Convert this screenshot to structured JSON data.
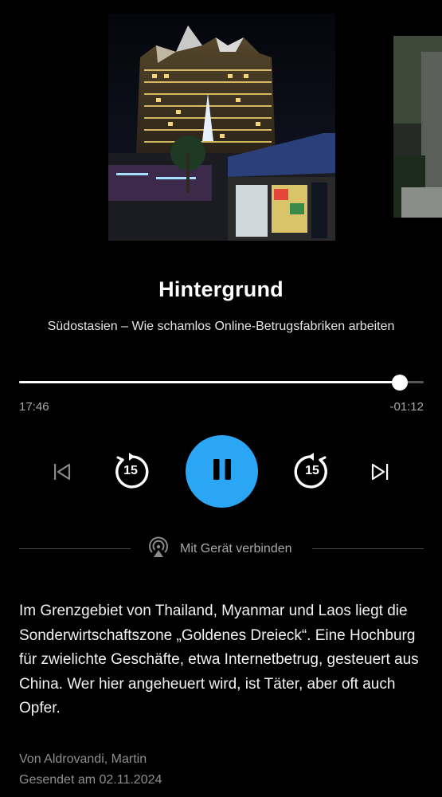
{
  "episode": {
    "title": "Hintergrund",
    "subtitle": "Südostasien – Wie schamlos Online-Betrugsfabriken arbeiten",
    "description": "Im Grenzgebiet von Thailand, Myanmar und Laos liegt die Sonderwirtschaftszone „Goldenes Dreieck“. Eine Hochburg für zwielichte Geschäfte, etwa Internetbetrug, gesteuert aus China. Wer hier angeheuert wird, ist Täter, aber oft auch Opfer.",
    "author": "Von Aldrovandi, Martin",
    "broadcast": "Gesendet am 02.11.2024"
  },
  "player": {
    "elapsed": "17:46",
    "remaining": "-01:12",
    "progress_fraction": 0.94,
    "skip_back_seconds": "15",
    "skip_forward_seconds": "15",
    "state": "playing",
    "accent_color": "#2ba6f5"
  },
  "connect": {
    "label": "Mit Gerät verbinden",
    "icon": "airplay-icon"
  },
  "icons": {
    "previous": "previous-track-icon",
    "rewind": "rewind-15-icon",
    "pause": "pause-icon",
    "forward": "forward-15-icon",
    "next": "next-track-icon"
  }
}
